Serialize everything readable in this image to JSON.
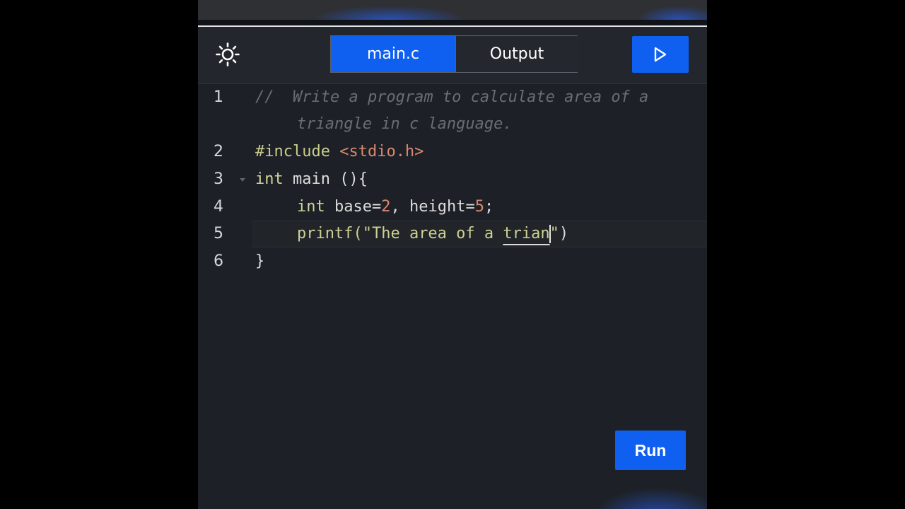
{
  "toolbar": {
    "theme_icon": "sun-icon",
    "tabs": [
      {
        "label": "main.c",
        "active": true
      },
      {
        "label": "Output",
        "active": false
      }
    ],
    "play_icon": "play-icon"
  },
  "editor": {
    "line_numbers": [
      "1",
      "2",
      "3",
      "4",
      "5",
      "6"
    ],
    "lines": {
      "l1a": "//  Write a program to calculate area of a",
      "l1b": "triangle in c language.",
      "l2_pre": "#include",
      "l2_inc": "<stdio.h>",
      "l3_kw": "int",
      "l3_rest": "main (){",
      "l4_kw": "int",
      "l4_a": "base=",
      "l4_n1": "2",
      "l4_b": ", height=",
      "l4_n2": "5",
      "l4_c": ";",
      "l5_fn": "printf(",
      "l5_str": "\"The area of a ",
      "l5_under": "trian",
      "l5_close_quote": "\"",
      "l5_paren": ")",
      "l6": "}"
    }
  },
  "run_button": {
    "label": "Run"
  },
  "colors": {
    "accent": "#0f5ff0",
    "editor_bg": "#1d2127",
    "comment": "#6a6e74",
    "string": "#ccd094",
    "number": "#d9896e"
  }
}
